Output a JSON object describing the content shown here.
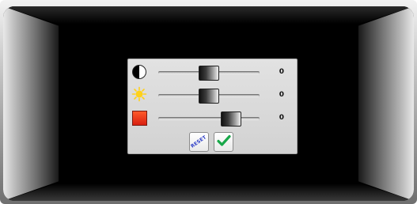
{
  "panel": {
    "sliders": [
      {
        "icon": "contrast-icon",
        "value": "0",
        "level": 0.5
      },
      {
        "icon": "sun-icon",
        "value": "0",
        "level": 0.5
      },
      {
        "icon": "color-square-icon",
        "value": "0",
        "level": 0.72
      }
    ],
    "reset_label": "RESET",
    "confirm_icon": "checkmark-icon"
  },
  "colors": {
    "sun": "#ffd11a",
    "color_square": "#e52d14",
    "checkmark": "#19a84a",
    "reset_text": "#2b3cc6"
  }
}
